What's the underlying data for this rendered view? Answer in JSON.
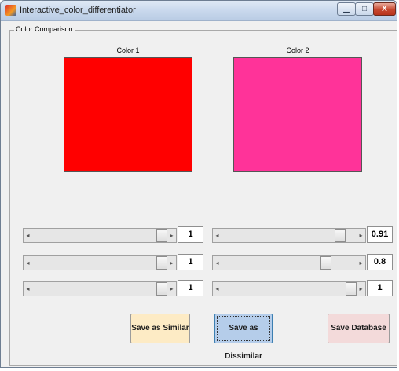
{
  "window": {
    "title": "Interactive_color_differentiator",
    "controls": {
      "minimize": "▁",
      "maximize": "□",
      "close": "X"
    }
  },
  "panel": {
    "title": "Color Comparison"
  },
  "colors": [
    {
      "label": "Color 1",
      "swatch": "#ff0000"
    },
    {
      "label": "Color 2",
      "swatch": "#ff3399"
    }
  ],
  "sliders": {
    "color1": [
      {
        "value": "1",
        "level": 1
      },
      {
        "value": "1",
        "level": 1
      },
      {
        "value": "1",
        "level": 1
      }
    ],
    "color2": [
      {
        "value": "0.91",
        "level": 0.91
      },
      {
        "value": "0.8",
        "level": 0.8
      },
      {
        "value": "1",
        "level": 1
      }
    ]
  },
  "buttons": {
    "similar": "Save as Similar",
    "dissimilar": "Save as Dissimilar",
    "database": "Save Database"
  }
}
